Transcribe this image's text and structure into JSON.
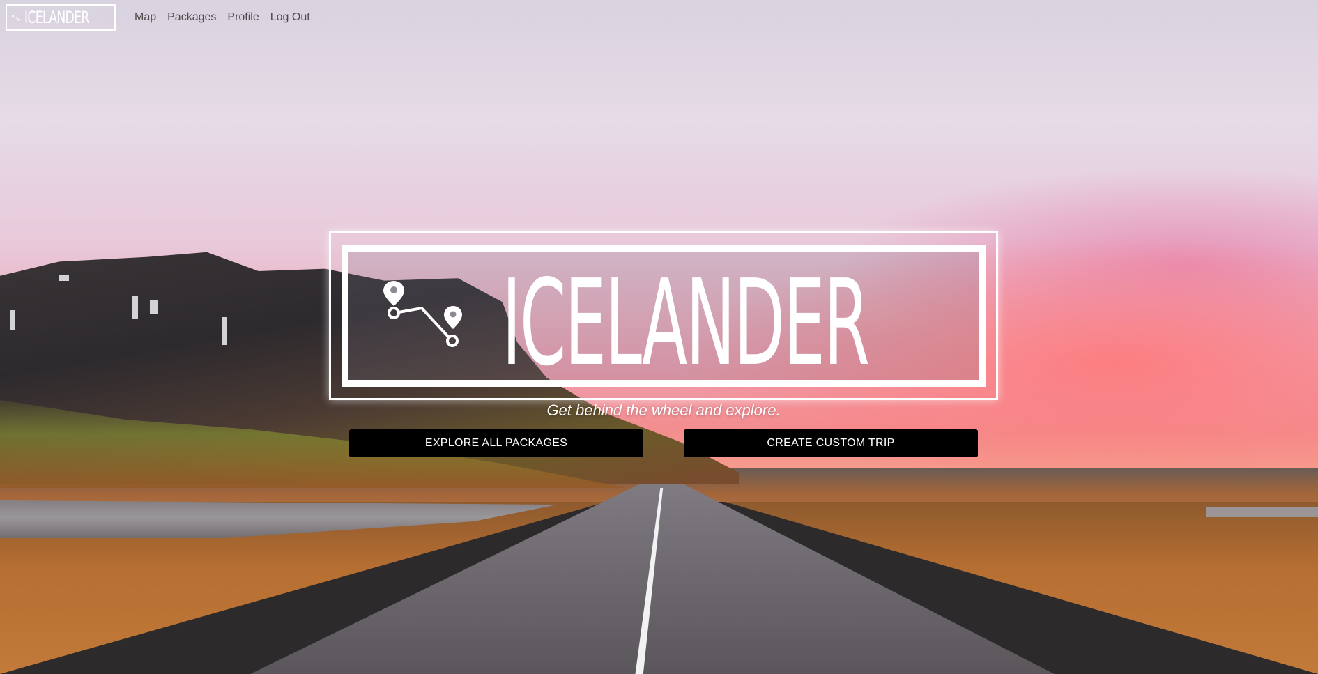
{
  "nav": {
    "logo_text": "ICELANDER",
    "links": [
      "Map",
      "Packages",
      "Profile",
      "Log Out"
    ]
  },
  "hero": {
    "title": "ICELANDER",
    "tagline": "Get behind the wheel and explore.",
    "icon": "route-pins-icon"
  },
  "actions": {
    "explore_label": "EXPLORE ALL PACKAGES",
    "create_label": "CREATE CUSTOM TRIP"
  },
  "colors": {
    "button_bg": "#000000",
    "button_text": "#ffffff",
    "nav_link": "#4a4a4a"
  }
}
